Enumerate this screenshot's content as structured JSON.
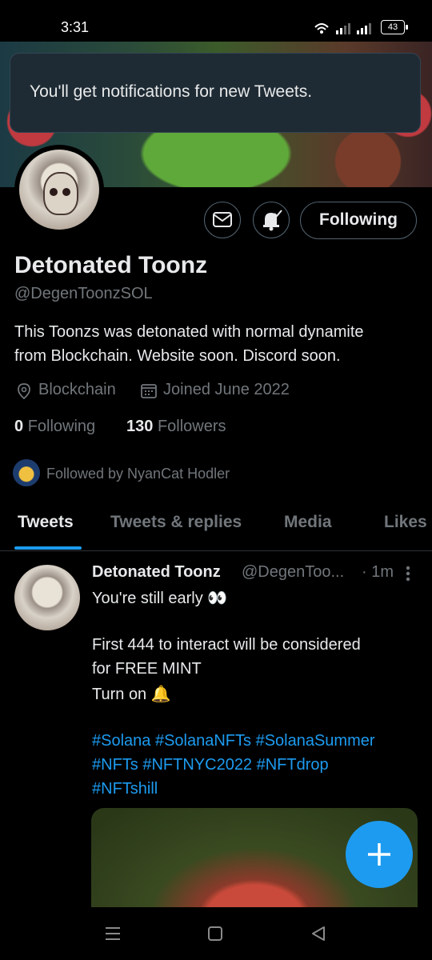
{
  "status_bar": {
    "time": "3:31",
    "battery": "43"
  },
  "toast": {
    "message": "You'll get notifications for new Tweets."
  },
  "profile": {
    "follow_button": "Following",
    "name": "Detonated Toonz",
    "handle": "@DegenToonzSOL",
    "bio_line1": "This Toonzs was detonated with normal dynamite",
    "bio_line2": "from Blockchain. Website soon. Discord soon.",
    "location": "Blockchain",
    "joined": "Joined June 2022",
    "following_count": "0",
    "following_label": "Following",
    "followers_count": "130",
    "followers_label": "Followers",
    "followed_by": "Followed by NyanCat Hodler"
  },
  "tabs": [
    {
      "label": "Tweets"
    },
    {
      "label": "Tweets & replies"
    },
    {
      "label": "Media"
    },
    {
      "label": "Likes"
    }
  ],
  "tweet": {
    "name": "Detonated Toonz",
    "handle": "@DegenToo...",
    "time": "· 1m",
    "line1": "You're still early 👀",
    "line2": "First 444 to interact will be considered",
    "line3": "for FREE MINT",
    "line4": "Turn on 🔔",
    "hashtags1": "#Solana  #SolanaNFTs  #SolanaSummer",
    "hashtags2": "#NFTs #NFTNYC2022 #NFTdrop",
    "hashtags3": "#NFTshill"
  },
  "colors": {
    "accent": "#1d9bf0",
    "background": "#000000",
    "secondary_text": "#71767b"
  },
  "icons": {
    "mail": "envelope-icon",
    "notify": "bell-check-icon",
    "location": "location-pin-icon",
    "calendar": "calendar-icon",
    "compose": "plus-icon"
  }
}
